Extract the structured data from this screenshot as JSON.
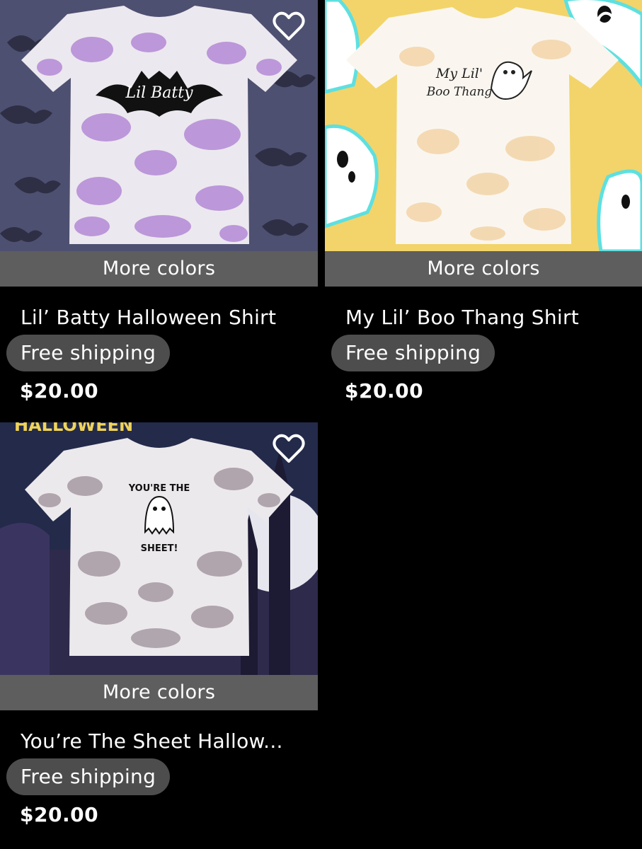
{
  "listings": [
    {
      "title": "Lil’ Batty Halloween Shirt",
      "more_colors": "More colors",
      "shipping": "Free shipping",
      "price": "$20.00",
      "shirt_text": "Lil Batty"
    },
    {
      "title": "My Lil’ Boo Thang Shirt",
      "more_colors": "More colors",
      "shipping": "Free shipping",
      "price": "$20.00",
      "shirt_text_line1": "My Lil'",
      "shirt_text_line2": "Boo Thang"
    },
    {
      "title": "You’re The Sheet Hallow...",
      "more_colors": "More colors",
      "shipping": "Free shipping",
      "price": "$20.00",
      "shirt_text_top": "YOU'RE THE",
      "shirt_text_bottom": "SHEET!",
      "banner_text": "HALLOWEEN"
    }
  ],
  "colors": {
    "background": "#000000",
    "more_colors_bar": "#5e5e5e",
    "badge": "#4d4d4d",
    "text": "#ffffff"
  }
}
